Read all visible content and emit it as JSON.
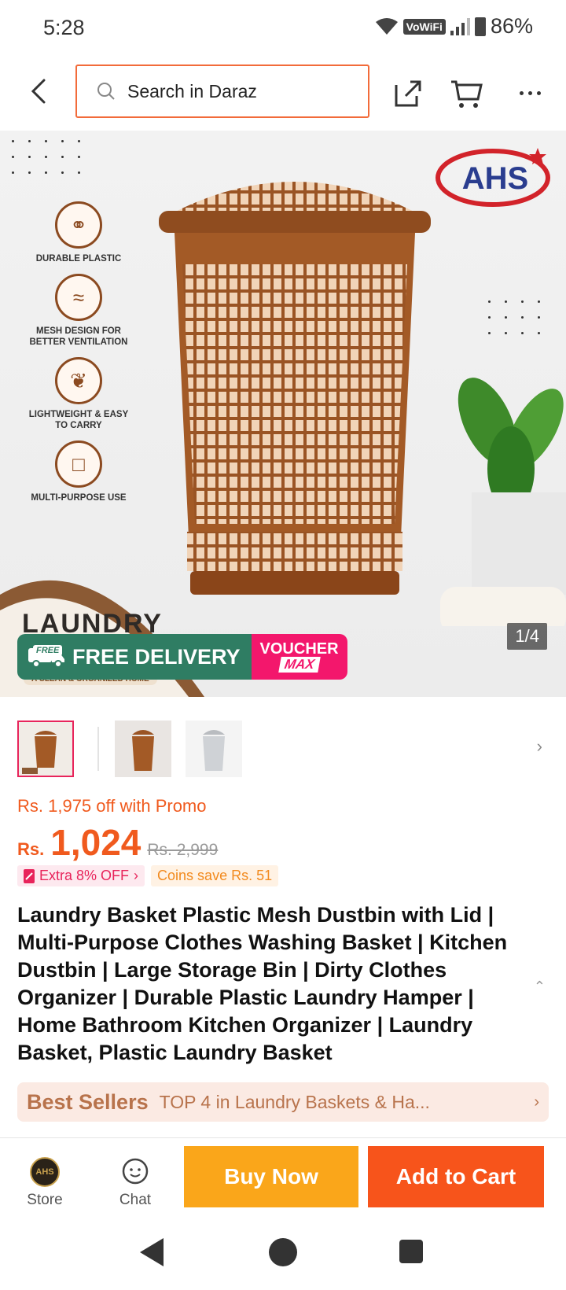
{
  "status_bar": {
    "time": "5:28",
    "network_badge": "VoWiFi",
    "battery": "86%"
  },
  "header": {
    "search_placeholder": "Search in Daraz",
    "icons": [
      "back-arrow-icon",
      "search-icon",
      "share-icon",
      "cart-icon",
      "more-icon"
    ]
  },
  "gallery": {
    "counter": "1/4",
    "brand_logo": "AHS",
    "features": [
      {
        "icon": "link-icon",
        "label": "DURABLE PLASTIC"
      },
      {
        "icon": "ventilation-icon",
        "label": "MESH DESIGN FOR BETTER VENTILATION"
      },
      {
        "icon": "feather-icon",
        "label": "LIGHTWEIGHT & EASY TO CARRY"
      },
      {
        "icon": "bin-icon",
        "label": "MULTI-PURPOSE USE"
      }
    ],
    "headline": "LAUNDRY",
    "subtag": "A CLEAN & ORGANIZED HOME",
    "promo": {
      "free_tag": "FREE",
      "free_delivery": "FREE DELIVERY",
      "voucher": "VOUCHER",
      "max": "MAX"
    },
    "thumbnails": 3
  },
  "pricing": {
    "promo_off": "Rs. 1,975 off with Promo",
    "currency": "Rs.",
    "price": "1,024",
    "original_price": "Rs. 2,999",
    "extra_off": "Extra 8% OFF",
    "coins": "Coins save Rs. 51"
  },
  "product": {
    "title": "Laundry Basket Plastic Mesh Dustbin with Lid | Multi-Purpose Clothes Washing Basket | Kitchen Dustbin | Large Storage Bin | Dirty Clothes Organizer | Durable Plastic Laundry Hamper | Home Bathroom Kitchen Organizer | Laundry Basket, Plastic Laundry Basket"
  },
  "best_sellers": {
    "label": "Best Sellers",
    "text": "TOP 4 in Laundry Baskets & Ha..."
  },
  "bottom_bar": {
    "store_label": "Store",
    "chat_label": "Chat",
    "buy_now": "Buy Now",
    "add_to_cart": "Add to Cart"
  },
  "colors": {
    "accent_orange": "#f7541b",
    "buy_yellow": "#faa61a",
    "price_orange": "#f05a1e",
    "pink": "#e8245b",
    "product_brown": "#8b4a20"
  }
}
